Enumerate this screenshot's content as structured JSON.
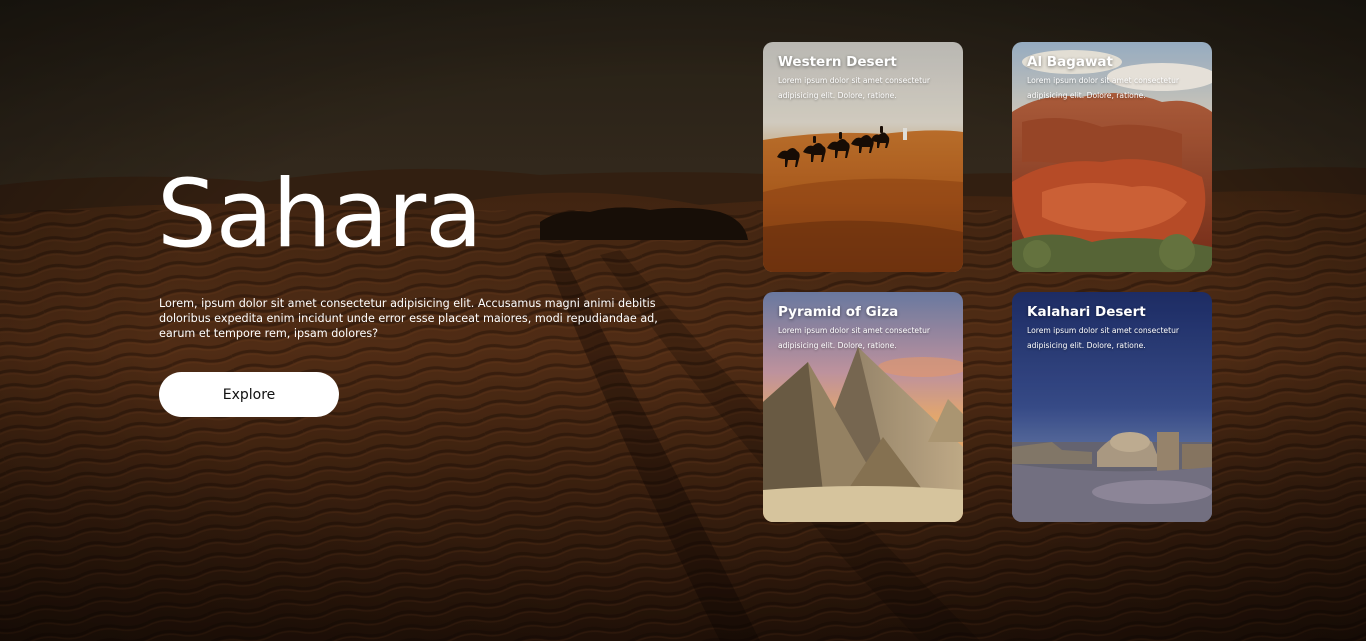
{
  "hero": {
    "title": "Sahara",
    "description": "Lorem, ipsum dolor sit amet consectetur adipisicing elit. Accusamus magni animi debitis doloribus expedita enim incidunt unde error esse placeat maiores, modi repudiandae ad, earum et tempore rem, ipsam dolores?",
    "button_label": "Explore"
  },
  "cards": [
    {
      "title": "Western Desert",
      "text": "Lorem ipsum dolor sit amet consectetur adipisicing elit. Dolore, ratione."
    },
    {
      "title": "Al Bagawat",
      "text": "Lorem ipsum dolor sit amet consectetur adipisicing elit. Dolore, ratione."
    },
    {
      "title": "Pyramid of Giza",
      "text": "Lorem ipsum dolor sit amet consectetur adipisicing elit. Dolore, ratione."
    },
    {
      "title": "Kalahari Desert",
      "text": "Lorem ipsum dolor sit amet consectetur adipisicing elit. Dolore, ratione."
    }
  ],
  "colors": {
    "text": "#ffffff",
    "button_bg": "#ffffff",
    "button_text": "#111111",
    "sand_dark": "#2a1a0e",
    "sand_mid": "#6b3a1c"
  }
}
